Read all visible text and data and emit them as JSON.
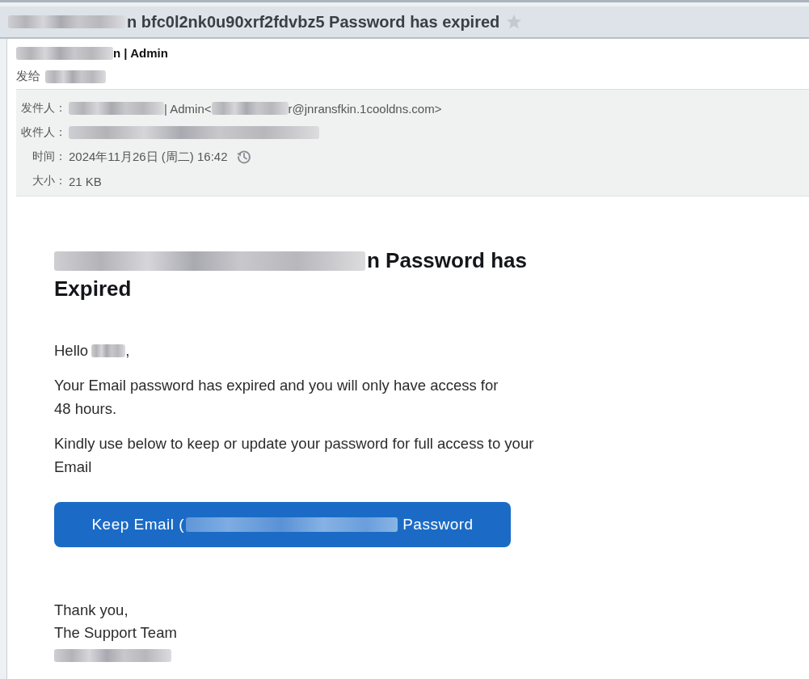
{
  "window": {
    "title": [
      {
        "kind": "redacted"
      },
      {
        "kind": "text",
        "text": "n bfc0l2nk0u90xrf2fdvbz5 Password has expired"
      }
    ],
    "starred": false
  },
  "header": {
    "sender": [
      {
        "kind": "redacted"
      },
      {
        "kind": "text",
        "text": "n | Admin"
      }
    ],
    "to": {
      "label": "发给",
      "parts": [
        {
          "kind": "redacted"
        }
      ]
    }
  },
  "details": [
    {
      "kind": "field",
      "label": "发件人：",
      "parts": [
        {
          "kind": "redacted"
        },
        {
          "kind": "text",
          "text": "| Admin<"
        },
        {
          "kind": "redacted"
        },
        {
          "kind": "text",
          "text": "r@jnransfkin.1cooldns.com>"
        }
      ]
    },
    {
      "kind": "field",
      "label": "收件人：",
      "parts": [
        {
          "kind": "redacted"
        }
      ]
    },
    {
      "kind": "time",
      "label": "时间：",
      "parts": [
        {
          "kind": "text",
          "text": "2024年11月26日 (周二) 16:42"
        }
      ]
    },
    {
      "kind": "field",
      "label": "大小：",
      "parts": [
        {
          "kind": "text",
          "text": "21 KB"
        }
      ]
    }
  ],
  "body": {
    "heading_lines": [
      [
        {
          "kind": "redacted"
        },
        {
          "kind": "text",
          "text": "n Password has"
        }
      ],
      [
        {
          "kind": "text",
          "text": "Expired"
        }
      ]
    ],
    "greeting": [
      {
        "kind": "text",
        "text": "Hello"
      },
      {
        "kind": "redacted"
      },
      {
        "kind": "text",
        "text": ","
      }
    ],
    "paragraphs": [
      "Your Email password has expired and you will only have access for\n48 hours.",
      "Kindly use below to keep or update your password for full access to your Email"
    ],
    "button": [
      {
        "kind": "text",
        "text": "Keep Email ("
      },
      {
        "kind": "redacted"
      },
      {
        "kind": "text",
        "text": "Password"
      }
    ],
    "closing": [
      "Thank you,",
      "The Support Team"
    ],
    "signature": [
      {
        "kind": "redacted"
      }
    ]
  }
}
